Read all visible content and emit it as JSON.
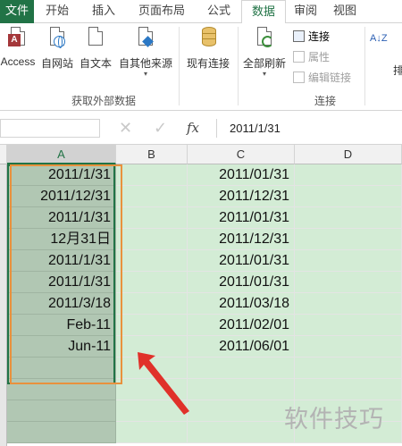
{
  "tabs": [
    {
      "label": "文件",
      "file": true
    },
    {
      "label": "开始"
    },
    {
      "label": "插入"
    },
    {
      "label": "页面布局"
    },
    {
      "label": "公式"
    },
    {
      "label": "数据",
      "active": true
    },
    {
      "label": "审阅"
    },
    {
      "label": "视图"
    }
  ],
  "ribbon": {
    "external_data": {
      "access": "Access",
      "web": "自网站",
      "text": "自文本",
      "other": "自其他来源",
      "existing": "现有连接",
      "group_label": "获取外部数据"
    },
    "connections": {
      "refresh_all": "全部刷新",
      "connections": "连接",
      "properties": "属性",
      "edit_links": "编辑链接",
      "group_label": "连接"
    },
    "sort_asc": "A↓Z",
    "sort_label": "排"
  },
  "formula_bar": {
    "name_box": "",
    "cancel": "✕",
    "enter": "✓",
    "fx": "fx",
    "value": "2011/1/31"
  },
  "grid": {
    "columns": [
      "A",
      "B",
      "C",
      "D"
    ],
    "selected_column": "A",
    "rows": [
      {
        "a": "2011/1/31",
        "c": "2011/01/31"
      },
      {
        "a": "2011/12/31",
        "c": "2011/12/31"
      },
      {
        "a": "2011/1/31",
        "c": "2011/01/31"
      },
      {
        "a": "12月31日",
        "c": "2011/12/31"
      },
      {
        "a": "2011/1/31",
        "c": "2011/01/31"
      },
      {
        "a": "2011/1/31",
        "c": "2011/01/31"
      },
      {
        "a": "2011/3/18",
        "c": "2011/03/18"
      },
      {
        "a": "Feb-11",
        "c": "2011/02/01"
      },
      {
        "a": "Jun-11",
        "c": "2011/06/01"
      }
    ]
  },
  "watermark": "软件技巧",
  "colors": {
    "accent": "#217346",
    "highlight_box": "#e9913d",
    "arrow": "#e0312a",
    "fill_green": "#d3ecd5",
    "fill_selected": "#b1c7b3"
  }
}
